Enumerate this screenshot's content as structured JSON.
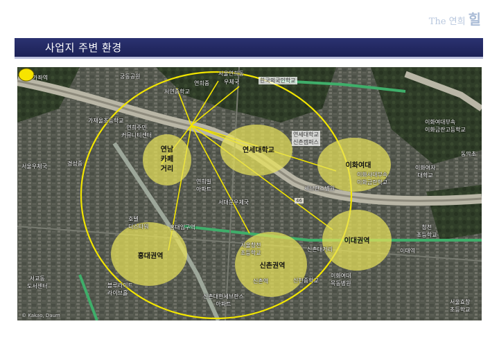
{
  "brand": {
    "text": "The 연희",
    "hanja": "힐"
  },
  "header": {
    "title": "사업지 주변 환경"
  },
  "map": {
    "zones": [
      {
        "id": "yeonnam",
        "label": "연남\n카페\n거리"
      },
      {
        "id": "yonsei",
        "label": "연세대학교"
      },
      {
        "id": "ewha",
        "label": "이화여대"
      },
      {
        "id": "hongdae",
        "label": "홍대권역"
      },
      {
        "id": "sinchon",
        "label": "신촌권역"
      },
      {
        "id": "idae",
        "label": "이대권역"
      }
    ],
    "labels": {
      "gajwa": "가좌역",
      "gungdong": "궁동공원",
      "yeonhuidong": "서울연희동",
      "post": "우체국",
      "yeonhui_school": "연희중",
      "hankook": "한국외국인학교",
      "seoyeon": "서연중학교",
      "yeonhui_elem": "연희초",
      "gaza_elem": "가재울초등학교",
      "yeonhui_community": "연희주민\n커뮤니티센터",
      "seoul_post": "서울우체국",
      "gyeongseong": "경성중",
      "yonsei_campus": "연세대학교\n신촌캠퍼스",
      "severance": "세브란스병원",
      "ewha_school": "이화여대부속\n이화금란고등학교",
      "ewha_univ": "이화여자\n대학교",
      "ewha_high": "이화사대부속\n이화금란학교",
      "seogyo_post": "서대문우체국",
      "yeonhui_apt": "연희빌\n아파트",
      "ditower": "호텔\n디스타워",
      "hongik_station": "홍대입구역",
      "sinchon_station": "신촌역",
      "sinchon_crossroad": "신촌대거리",
      "sinchon_middle": "신천중학교",
      "idae_station": "이대역",
      "dongmak": "동막초",
      "seogang": "서강대",
      "seogyo_lib": "서교동\n도서센터",
      "bluelight": "블루라이트\n라이브홀",
      "sinchon_yonsei": "신촌대한세브란스\n아파트",
      "changcheon": "창천\n초등학교",
      "ewha_univ_hospital": "이화여대\n목동병원",
      "seoul_hyochang": "서울효창\n초등학교",
      "maengyo": "만경중\n초등학교",
      "road_num": "46",
      "hyundai_apt": "신촌세브란스",
      "station_mark": "서울창천\n초등학교",
      "dongsung": "동성고",
      "hongdae_mid": "홍대부속\n여자중학교",
      "copyright": "© Kakao, Daum"
    }
  }
}
